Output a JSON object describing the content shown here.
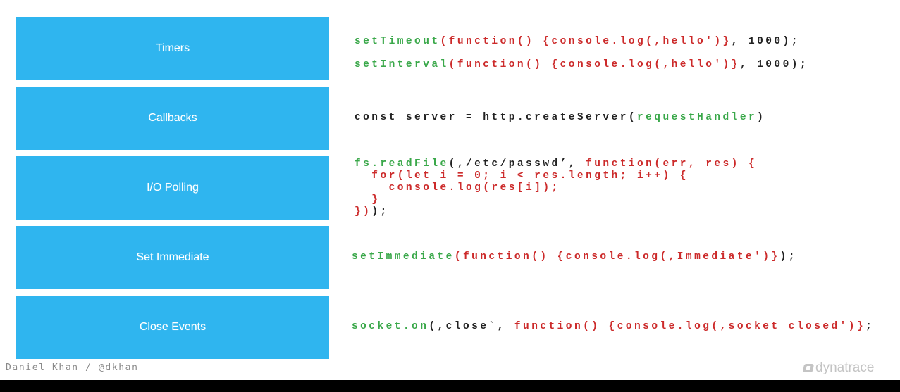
{
  "colors": {
    "phase_bg": "#2fb5ef",
    "green": "#3aa84a",
    "red": "#cc2a2a",
    "dark": "#222222"
  },
  "phases": [
    {
      "label": "Timers"
    },
    {
      "label": "Callbacks"
    },
    {
      "label": "I/O Polling"
    },
    {
      "label": "Set Immediate"
    },
    {
      "label": "Close Events"
    }
  ],
  "code_blocks": [
    {
      "lines": [
        [
          [
            "setTimeout",
            "green"
          ],
          [
            "(function() {console.log(,hello')}",
            "red"
          ],
          [
            ", 1000);",
            "dark"
          ]
        ],
        [
          [
            "setInterval",
            "green"
          ],
          [
            "(function() {console.log(,hello')}",
            "red"
          ],
          [
            ", 1000);",
            "dark"
          ]
        ]
      ]
    },
    {
      "lines": [
        [
          [
            "const server = http.createServer(",
            "dark"
          ],
          [
            "requestHandler",
            "green"
          ],
          [
            ")",
            "dark"
          ]
        ]
      ]
    },
    {
      "lines": [
        [
          [
            "fs.readFile",
            "green"
          ],
          [
            "(,/etc/passwd’, ",
            "dark"
          ],
          [
            "function(err, res) {",
            "red"
          ]
        ],
        [
          [
            "  for(let i = 0; i < res.length; i++) {",
            "red"
          ]
        ],
        [
          [
            "    console.log(res[i]);",
            "red"
          ]
        ],
        [
          [
            "  }",
            "red"
          ]
        ],
        [
          [
            "})",
            "red"
          ],
          [
            ");",
            "dark"
          ]
        ]
      ]
    },
    {
      "lines": [
        [
          [
            "setImmediate",
            "green"
          ],
          [
            "(function() {console.log(,Immediate')}",
            "red"
          ],
          [
            ");",
            "dark"
          ]
        ]
      ]
    },
    {
      "lines": [
        [
          [
            "socket.on",
            "green"
          ],
          [
            "(,close`, ",
            "dark"
          ],
          [
            "function() {console.log(,socket closed')}",
            "red"
          ],
          [
            ";",
            "dark"
          ]
        ]
      ]
    }
  ],
  "footer": {
    "author": "Daniel Khan / @dkhan",
    "logo_text": "dynatrace"
  }
}
